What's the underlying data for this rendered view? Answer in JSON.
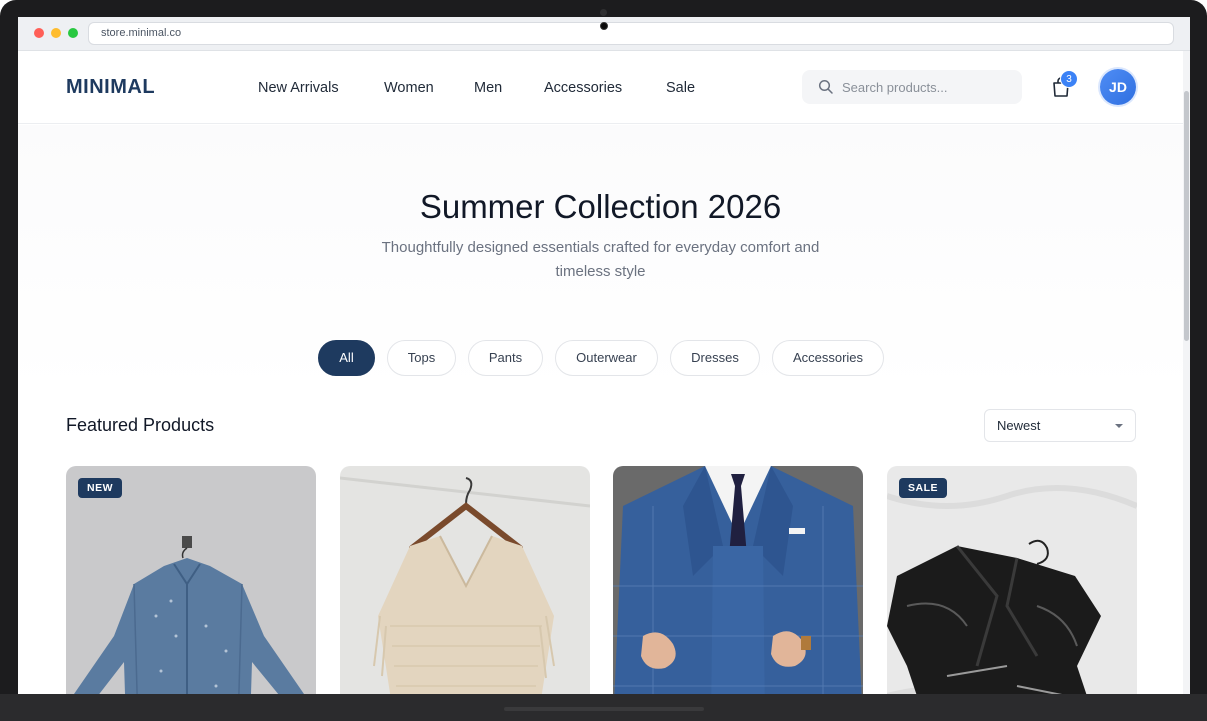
{
  "browser": {
    "url": "store.minimal.co"
  },
  "header": {
    "logo": "MINIMAL",
    "nav": [
      "New Arrivals",
      "Women",
      "Men",
      "Accessories",
      "Sale"
    ],
    "search_placeholder": "Search products...",
    "cart_count": "3",
    "avatar_initials": "JD"
  },
  "hero": {
    "title": "Summer Collection 2026",
    "subtitle": "Thoughtfully designed essentials crafted for everyday comfort and timeless style"
  },
  "filters": {
    "items": [
      "All",
      "Tops",
      "Pants",
      "Outerwear",
      "Dresses",
      "Accessories"
    ],
    "active": "All"
  },
  "products_section": {
    "title": "Featured Products",
    "sort_selected": "Newest"
  },
  "products": [
    {
      "badge": "NEW",
      "image": "denim-shirt-on-hanger"
    },
    {
      "badge": "",
      "image": "knit-poncho-top-on-hanger"
    },
    {
      "badge": "",
      "image": "blue-plaid-three-piece-suit"
    },
    {
      "badge": "SALE",
      "image": "black-leather-jacket"
    }
  ],
  "colors": {
    "brand": "#1e3a5f",
    "accent": "#3b82f6",
    "text": "#111827"
  }
}
